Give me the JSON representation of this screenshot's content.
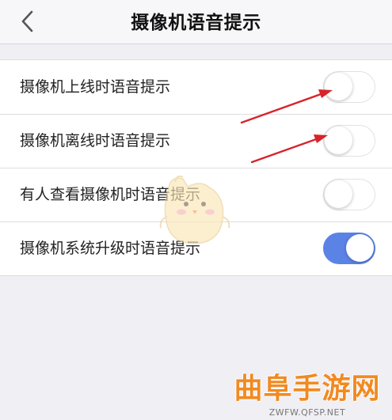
{
  "navbar": {
    "title": "摄像机语音提示",
    "back_icon": "chevron-left-icon"
  },
  "settings": [
    {
      "label": "摄像机上线时语音提示",
      "enabled": false
    },
    {
      "label": "摄像机离线时语音提示",
      "enabled": false
    },
    {
      "label": "有人查看摄像机时语音提示",
      "enabled": false
    },
    {
      "label": "摄像机系统升级时语音提示",
      "enabled": true
    }
  ],
  "colors": {
    "toggle_on": "#5b83e6",
    "toggle_off_border": "#e2e2e6",
    "annotation_arrow": "#d8232a",
    "background": "#efeff4"
  },
  "watermark": {
    "logo": "曲阜手游网",
    "url": "ZWFW.QFSP.NET"
  }
}
